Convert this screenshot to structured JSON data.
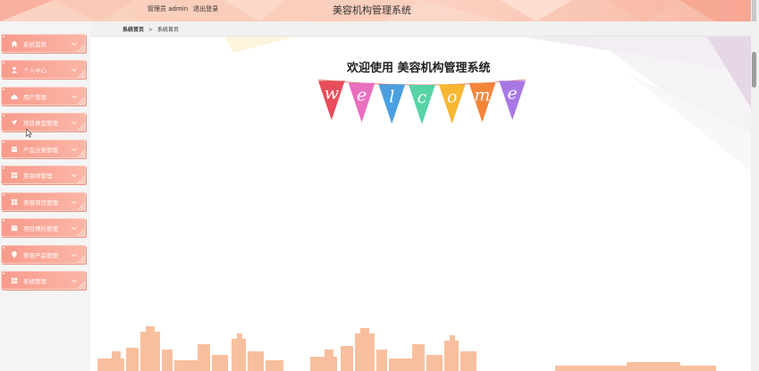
{
  "header": {
    "user_label": "管理员 admin",
    "logout_label": "退出登录",
    "title": "美容机构管理系统"
  },
  "sidebar": {
    "items": [
      {
        "label": "系统首页",
        "icon": "home-icon"
      },
      {
        "label": "个人中心",
        "icon": "user-icon"
      },
      {
        "label": "用户管理",
        "icon": "users-icon"
      },
      {
        "label": "项目类型管理",
        "icon": "plane-icon"
      },
      {
        "label": "产品分类管理",
        "icon": "box-icon"
      },
      {
        "label": "美容师管理",
        "icon": "grid-icon"
      },
      {
        "label": "美容项目管理",
        "icon": "grid-icon"
      },
      {
        "label": "项目预约管理",
        "icon": "calendar-icon"
      },
      {
        "label": "美容产品管理",
        "icon": "pin-icon"
      },
      {
        "label": "系统管理",
        "icon": "grid-icon"
      }
    ]
  },
  "breadcrumb": {
    "home": "系统首页",
    "separator": ">",
    "current": "系统首页"
  },
  "main": {
    "welcome_text": "欢迎使用 美容机构管理系统",
    "banner_letters": [
      "w",
      "e",
      "l",
      "c",
      "o",
      "m",
      "e"
    ],
    "banner_colors": [
      "#e84d5b",
      "#e96fbf",
      "#4a9fe0",
      "#57d3a6",
      "#f6b732",
      "#f3853b",
      "#a879e4"
    ]
  },
  "colors": {
    "menu_bg": "#f89b8c",
    "header_bg": "#fbd3c4",
    "skyline": "#f7b58e"
  }
}
